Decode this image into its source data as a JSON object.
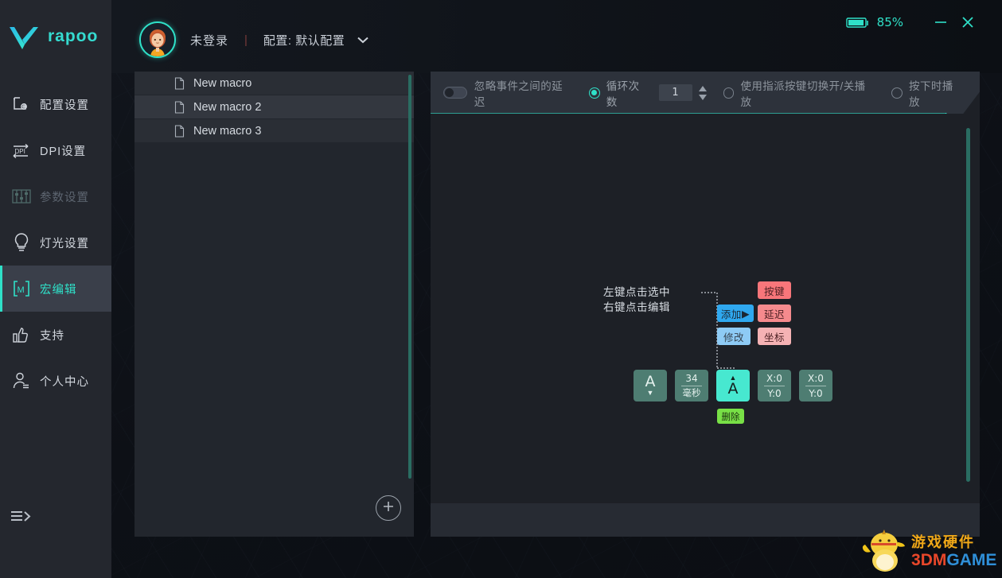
{
  "brand": {
    "name": "rapoo",
    "logo_icon": "rapoo-v-logo"
  },
  "sidebar": {
    "items": [
      {
        "label": "配置设置",
        "icon": "config-settings-icon",
        "state": "normal"
      },
      {
        "label": "DPI设置",
        "icon": "dpi-settings-icon",
        "state": "normal"
      },
      {
        "label": "参数设置",
        "icon": "parameter-settings-icon",
        "state": "disabled"
      },
      {
        "label": "灯光设置",
        "icon": "lighting-settings-icon",
        "state": "normal"
      },
      {
        "label": "宏编辑",
        "icon": "macro-editor-icon",
        "state": "active"
      },
      {
        "label": "支持",
        "icon": "support-thumbsup-icon",
        "state": "normal"
      },
      {
        "label": "个人中心",
        "icon": "user-profile-icon",
        "state": "normal"
      }
    ],
    "collapse_icon": "collapse-menu-icon"
  },
  "header": {
    "avatar_icon": "user-avatar",
    "user_status": "未登录",
    "separator": "|",
    "config_label": "配置: 默认配置",
    "caret_icon": "chevron-down-icon",
    "battery_icon": "battery-icon",
    "battery_percent": "85%",
    "minimize_icon": "minimize-icon",
    "close_icon": "close-icon"
  },
  "macro_list": {
    "items": [
      {
        "name": "New macro",
        "icon": "document-icon",
        "selected": false
      },
      {
        "name": "New macro 2",
        "icon": "document-icon",
        "selected": true
      },
      {
        "name": "New macro 3",
        "icon": "document-icon",
        "selected": false
      }
    ],
    "add_icon": "plus-circle-icon"
  },
  "toolbar": {
    "ignore_delay_label": "忽略事件之间的延迟",
    "ignore_delay_on": false,
    "loop_count_label": "循环次数",
    "loop_count_selected": true,
    "loop_count_value": "1",
    "spinner_icon": "spinner-up-down-icon",
    "toggle_play_label": "使用指派按键切换开/关播放",
    "toggle_play_selected": false,
    "play_on_press_label": "按下时播放",
    "play_on_press_selected": false
  },
  "editor": {
    "hint_line1": "左键点击选中",
    "hint_line2": "右键点击编辑",
    "actions": {
      "add_label": "添加",
      "add_arrow": "▶",
      "modify_label": "修改",
      "key_label": "按键",
      "delay_label": "延迟",
      "coord_label": "坐标"
    },
    "delete_label": "删除",
    "events": [
      {
        "type": "key-up-event",
        "glyph": "A",
        "arrow": "▼",
        "arrow_pos": "bottom",
        "selected": false
      },
      {
        "type": "delay-event",
        "top": "34",
        "bottom": "毫秒",
        "selected": false
      },
      {
        "type": "key-down-event",
        "glyph": "A",
        "arrow": "▲",
        "arrow_pos": "top",
        "selected": true
      },
      {
        "type": "coordinate-event",
        "top": "X:0",
        "bottom": "Y:0",
        "selected": false
      },
      {
        "type": "coordinate-event",
        "top": "X:0",
        "bottom": "Y:0",
        "selected": false
      }
    ]
  },
  "watermark": {
    "mascot_icon": "duck-mascot-icon",
    "cn_text": "游戏硬件",
    "en_part1": "3",
    "en_part2": "DM",
    "en_part3": "GAME"
  },
  "colors": {
    "accent": "#2fe0c8",
    "sidebar_bg": "#24272e",
    "panel_bg": "#22262d",
    "editor_bg": "#1d2026"
  }
}
